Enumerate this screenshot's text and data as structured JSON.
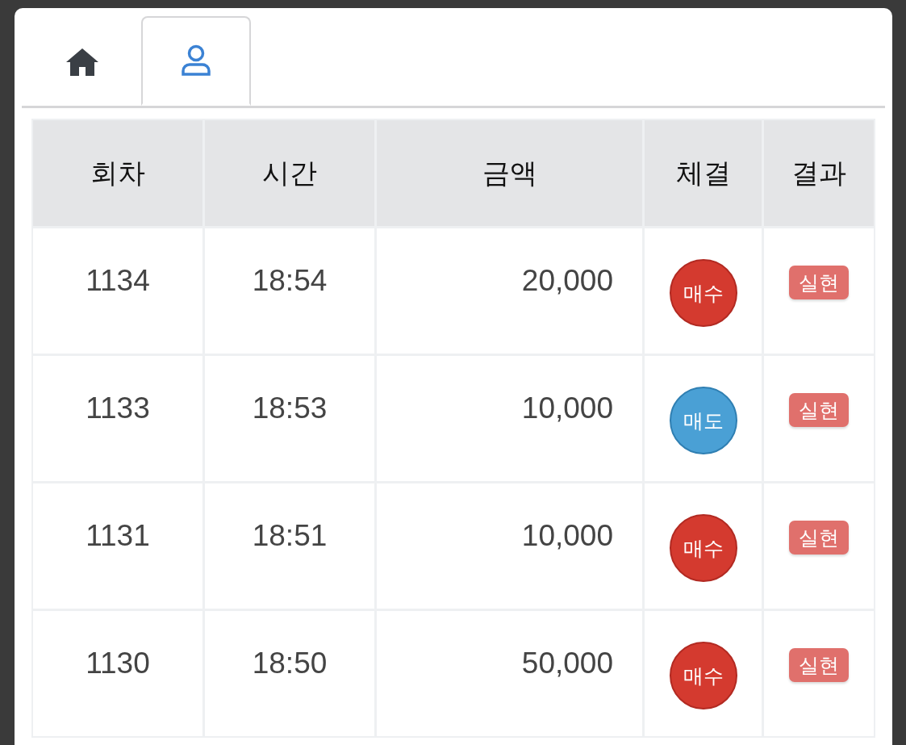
{
  "tabs": [
    {
      "kind": "home",
      "selected": false
    },
    {
      "kind": "user",
      "selected": true
    }
  ],
  "table": {
    "columns": [
      "회차",
      "시간",
      "금액",
      "체결",
      "결과"
    ],
    "rows": [
      {
        "round": "1134",
        "time": "18:54",
        "amount": "20,000",
        "trade": {
          "label": "매수",
          "kind": "buy"
        },
        "result": "실현"
      },
      {
        "round": "1133",
        "time": "18:53",
        "amount": "10,000",
        "trade": {
          "label": "매도",
          "kind": "sell"
        },
        "result": "실현"
      },
      {
        "round": "1131",
        "time": "18:51",
        "amount": "10,000",
        "trade": {
          "label": "매수",
          "kind": "buy"
        },
        "result": "실현"
      },
      {
        "round": "1130",
        "time": "18:50",
        "amount": "50,000",
        "trade": {
          "label": "매수",
          "kind": "buy"
        },
        "result": "실현"
      }
    ]
  }
}
